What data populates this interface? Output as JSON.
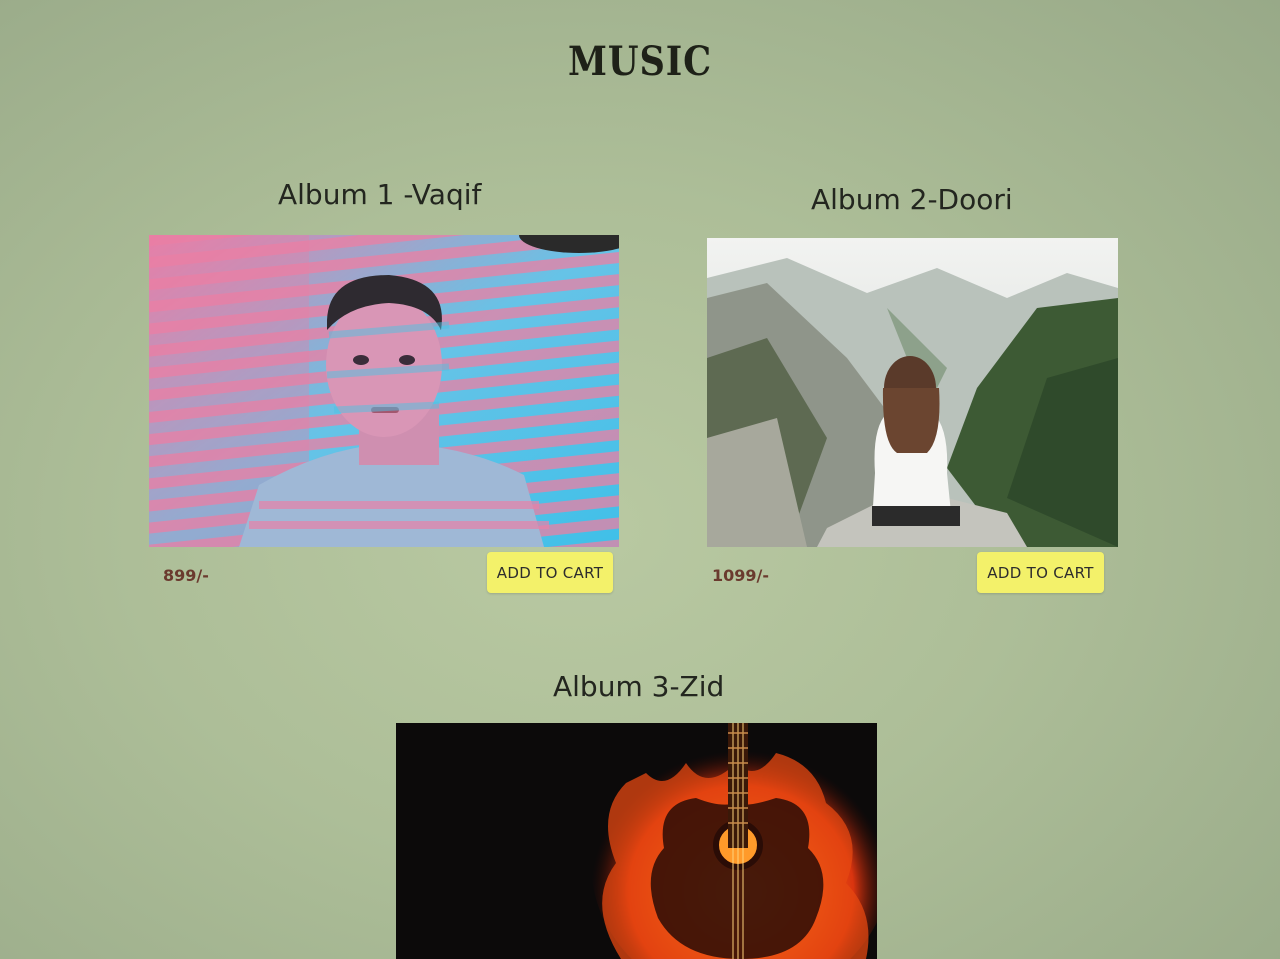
{
  "page": {
    "title": "MUSIC",
    "background": "#adbe98"
  },
  "albums": [
    {
      "title": "Album 1 -Vaqif",
      "price": "899/-",
      "button_label": "ADD TO CART",
      "image": "man-with-striped-neon-light-portrait"
    },
    {
      "title": "Album 2-Doori",
      "price": "1099/-",
      "button_label": "ADD TO CART",
      "image": "woman-sitting-on-mountain-cliff"
    },
    {
      "title": "Album 3-Zid",
      "image": "flaming-guitar"
    }
  ],
  "colors": {
    "button": "#f3f16a",
    "price": "#6a3a2e",
    "title": "#23261f"
  }
}
